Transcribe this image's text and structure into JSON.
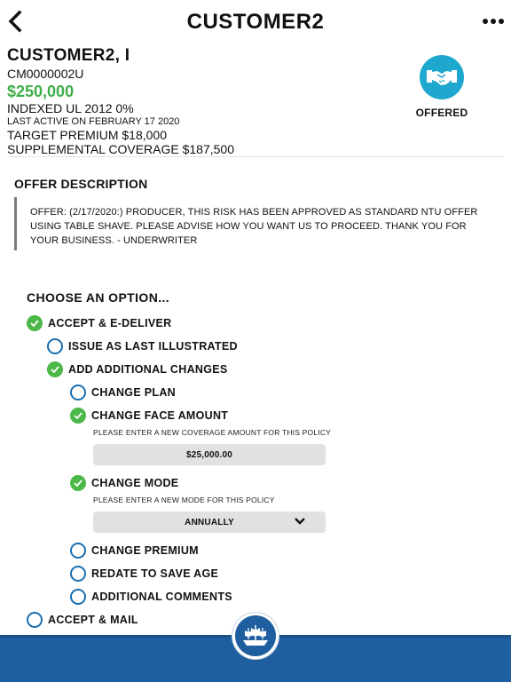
{
  "header": {
    "title": "CUSTOMER2"
  },
  "customer": {
    "name": "CUSTOMER2, I",
    "policy_number": "CM0000002U",
    "amount": "$250,000",
    "product": "INDEXED UL 2012 0%",
    "last_active": "LAST ACTIVE ON FEBRUARY 17 2020",
    "target_premium": "TARGET PREMIUM $18,000",
    "supplemental_coverage": "SUPPLEMENTAL COVERAGE $187,500"
  },
  "status": {
    "label": "OFFERED",
    "icon": "handshake-icon",
    "color": "#1fa8cf"
  },
  "offer": {
    "heading": "OFFER DESCRIPTION",
    "text": "OFFER: (2/17/2020:) PRODUCER, THIS RISK HAS BEEN APPROVED AS STANDARD NTU OFFER USING TABLE SHAVE. PLEASE ADVISE HOW YOU WANT US TO PROCEED. THANK YOU FOR YOUR BUSINESS. - UNDERWRITER"
  },
  "options": {
    "heading": "CHOOSE AN OPTION...",
    "accept_edeliver": {
      "label": "ACCEPT & E-DELIVER",
      "checked": true
    },
    "issue_last_illustrated": {
      "label": "ISSUE AS LAST ILLUSTRATED",
      "checked": false
    },
    "add_additional_changes": {
      "label": "ADD ADDITIONAL CHANGES",
      "checked": true
    },
    "change_plan": {
      "label": "CHANGE PLAN",
      "checked": false
    },
    "change_face_amount": {
      "label": "CHANGE FACE AMOUNT",
      "checked": true,
      "hint": "PLEASE ENTER A NEW COVERAGE AMOUNT FOR THIS POLICY",
      "value": "$25,000.00"
    },
    "change_mode": {
      "label": "CHANGE MODE",
      "checked": true,
      "hint": "PLEASE ENTER A NEW MODE FOR THIS POLICY",
      "selected": "ANNUALLY"
    },
    "change_premium": {
      "label": "CHANGE PREMIUM",
      "checked": false
    },
    "redate_save_age": {
      "label": "REDATE TO SAVE AGE",
      "checked": false
    },
    "additional_comments": {
      "label": "ADDITIONAL COMMENTS",
      "checked": false
    },
    "accept_mail": {
      "label": "ACCEPT & MAIL",
      "checked": false
    }
  },
  "colors": {
    "accent_green": "#3fae49",
    "check_green": "#4cb848",
    "radio_blue": "#1a6fb0",
    "bar_blue": "#1f5fa0"
  }
}
